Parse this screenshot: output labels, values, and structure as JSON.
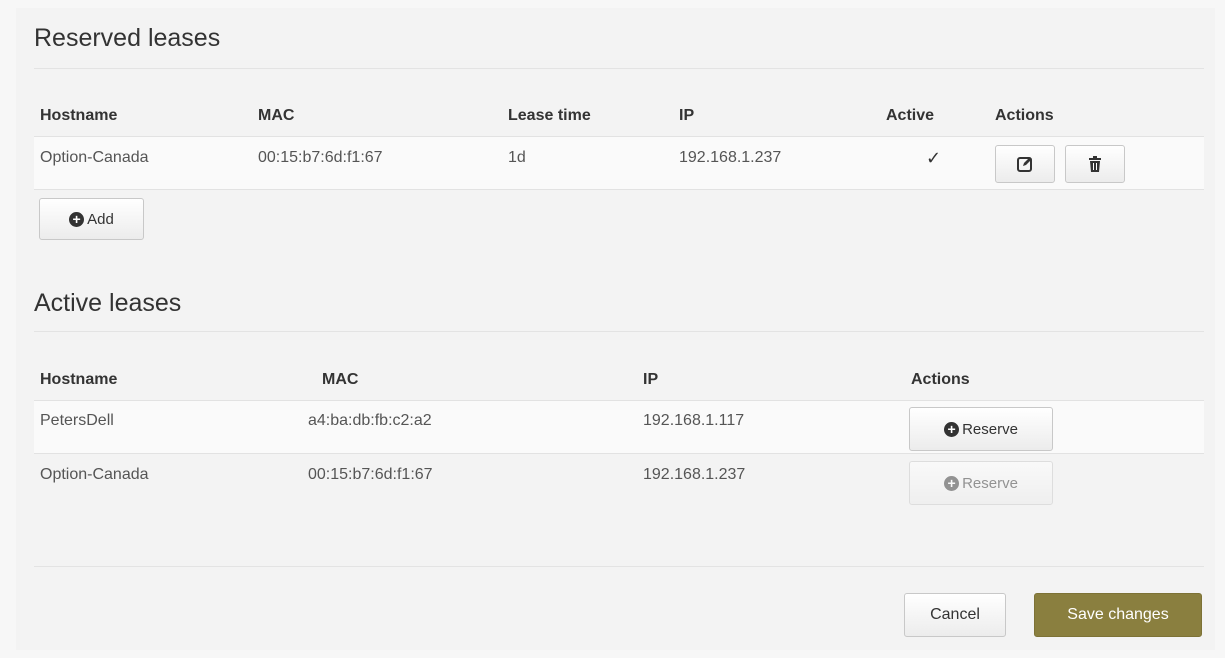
{
  "reserved": {
    "title": "Reserved leases",
    "headers": {
      "hostname": "Hostname",
      "mac": "MAC",
      "lease_time": "Lease time",
      "ip": "IP",
      "active": "Active",
      "actions": "Actions"
    },
    "rows": [
      {
        "hostname": "Option-Canada",
        "mac": "00:15:b7:6d:f1:67",
        "lease_time": "1d",
        "ip": "192.168.1.237",
        "active": "✓"
      }
    ],
    "add_label": "Add"
  },
  "active": {
    "title": "Active leases",
    "headers": {
      "hostname": "Hostname",
      "mac": "MAC",
      "ip": "IP",
      "actions": "Actions"
    },
    "rows": [
      {
        "hostname": "PetersDell",
        "mac": "a4:ba:db:fb:c2:a2",
        "ip": "192.168.1.117",
        "reserve_label": "Reserve",
        "reserve_enabled": true
      },
      {
        "hostname": "Option-Canada",
        "mac": "00:15:b7:6d:f1:67",
        "ip": "192.168.1.237",
        "reserve_label": "Reserve",
        "reserve_enabled": false
      }
    ]
  },
  "footer": {
    "cancel_label": "Cancel",
    "save_label": "Save changes"
  },
  "colors": {
    "primary": "#8a7f3f"
  }
}
